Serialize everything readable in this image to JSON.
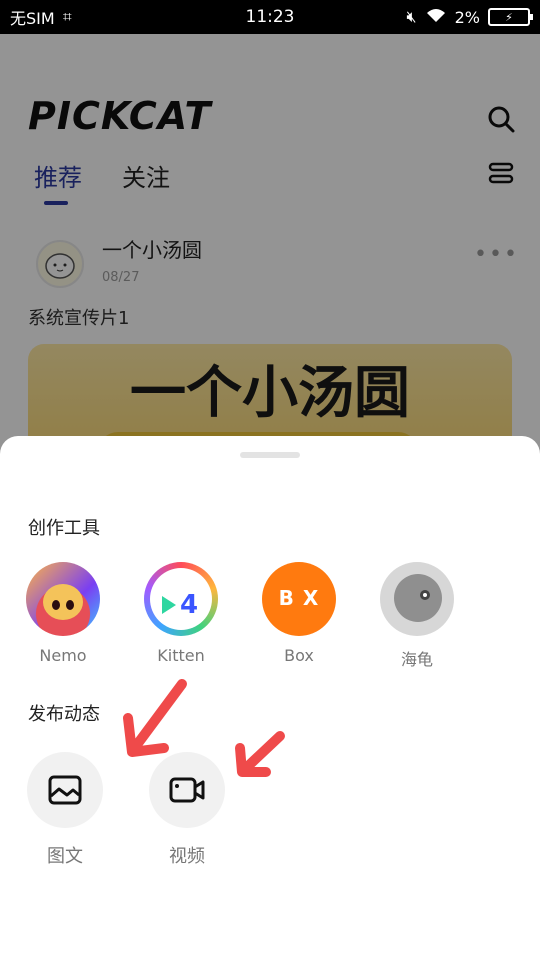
{
  "status_bar": {
    "carrier": "无SIM",
    "time": "11:23",
    "battery": "2%"
  },
  "app": {
    "logo": "PICKCAT",
    "tabs": [
      {
        "label": "推荐",
        "active": true
      },
      {
        "label": "关注",
        "active": false
      }
    ],
    "post": {
      "author": "一个小汤圆",
      "date": "08/27",
      "more": "•••",
      "text": "系统宣传片1",
      "image_title": "一个小汤圆"
    }
  },
  "sheet": {
    "tools_title": "创作工具",
    "tools": [
      {
        "label": "Nemo",
        "icon": "nemo-app-icon"
      },
      {
        "label": "Kitten",
        "icon": "kitten-app-icon"
      },
      {
        "label": "Box",
        "icon": "box-app-icon",
        "logo_text": "B X"
      },
      {
        "label": "海龟",
        "icon": "turtle-app-icon"
      }
    ],
    "publish_title": "发布动态",
    "publish": [
      {
        "label": "图文",
        "icon": "image-post-icon"
      },
      {
        "label": "视频",
        "icon": "video-post-icon"
      }
    ]
  },
  "colors": {
    "accent": "#2b3aa0",
    "arrow": "#ef4a4a",
    "overlay": "rgba(0,0,0,0.42)"
  }
}
